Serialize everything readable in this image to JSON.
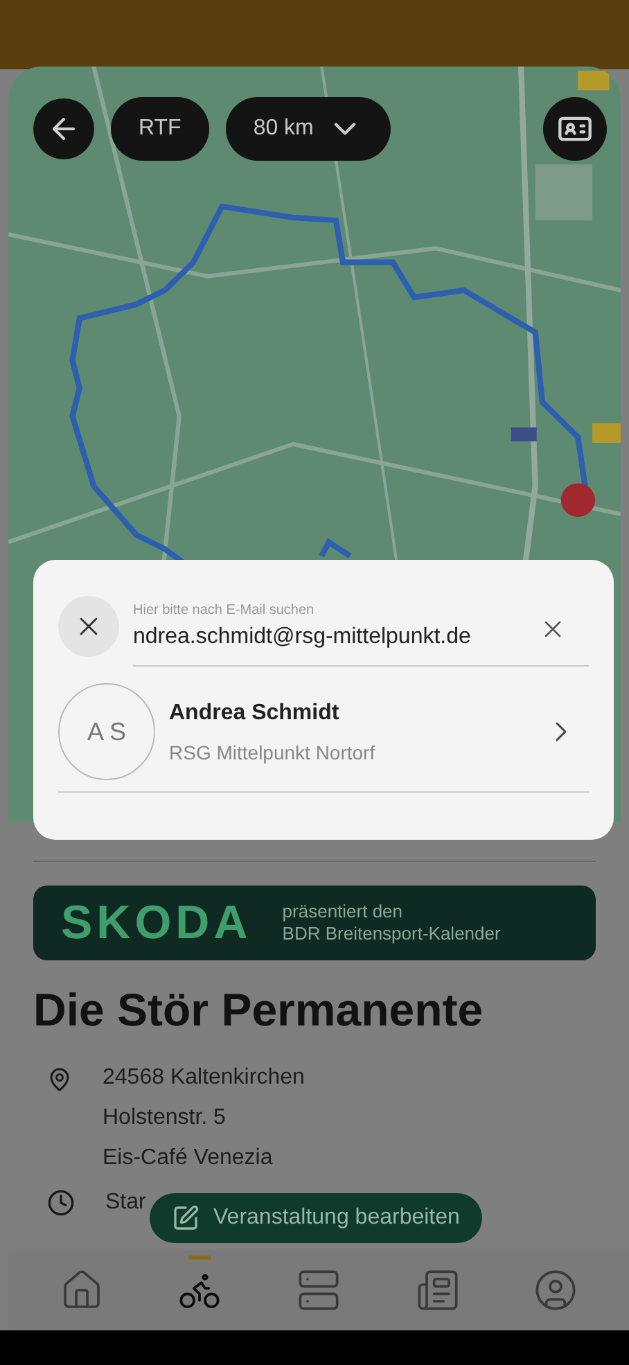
{
  "map_controls": {
    "chips": [
      {
        "kind": "text",
        "label": "RTF"
      },
      {
        "kind": "dropdown",
        "label": "80 km"
      }
    ]
  },
  "search_dialog": {
    "search": {
      "placeholder": "Hier bitte nach E-Mail suchen",
      "value": "ndrea.schmidt@rsg-mittelpunkt.de"
    },
    "results": [
      {
        "initials": "A S",
        "name": "Andrea Schmidt",
        "club": "RSG Mittelpunkt Nortorf"
      }
    ]
  },
  "sponsor_banner": {
    "logo": "SKODA",
    "line_1": "präsentiert den",
    "line_2": "BDR Breitensport-Kalender"
  },
  "event": {
    "title": "Die Stör Permanente",
    "location": [
      "24568 Kaltenkirchen",
      "Holstenstr. 5",
      "Eis-Café Venezia"
    ],
    "start": "Star"
  },
  "edit_button": {
    "label": "Veranstaltung bearbeiten"
  },
  "bottom_nav": [
    {
      "kind": "home",
      "selected": false
    },
    {
      "kind": "bike",
      "selected": true
    },
    {
      "kind": "list",
      "selected": false
    },
    {
      "kind": "news",
      "selected": false
    },
    {
      "kind": "profile",
      "selected": false
    }
  ]
}
